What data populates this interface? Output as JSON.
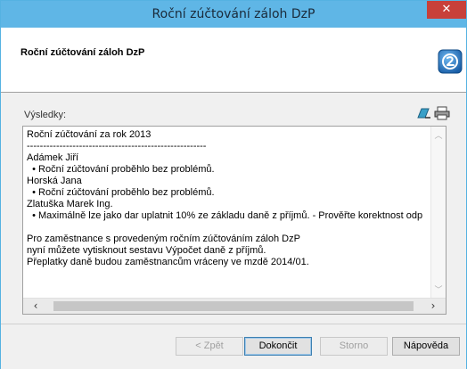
{
  "window": {
    "title": "Roční zúčtování záloh DzP",
    "close_glyph": "✕"
  },
  "header": {
    "title": "Roční zúčtování záloh DzP",
    "icon": "wizard-next-icon"
  },
  "results": {
    "label": "Výsledky:",
    "tools": [
      "edit-icon",
      "print-icon"
    ],
    "lines": [
      "Roční zúčtování za rok 2013",
      "-------------------------------------------------------",
      "Adámek Jiří",
      "  • Roční zúčtování proběhlo bez problémů.",
      "Horská Jana",
      "  • Roční zúčtování proběhlo bez problémů.",
      "Zlatuška Marek Ing.",
      "  • Maximálně lze jako dar uplatnit 10% ze základu daně z příjmů. - Prověřte korektnost odp",
      "",
      "Pro zaměstnance s provedeným ročním zúčtováním záloh DzP",
      "nyní můžete vytisknout sestavu Výpočet daně z příjmů.",
      "Přeplatky daně budou zaměstnancům vráceny ve mzdě 2014/01."
    ]
  },
  "buttons": {
    "back": "< Zpět",
    "finish": "Dokončit",
    "cancel": "Storno",
    "help": "Nápověda"
  },
  "colors": {
    "titlebar": "#5fb6e6",
    "close": "#c8403a",
    "icon_blue": "#1e6fb8"
  }
}
